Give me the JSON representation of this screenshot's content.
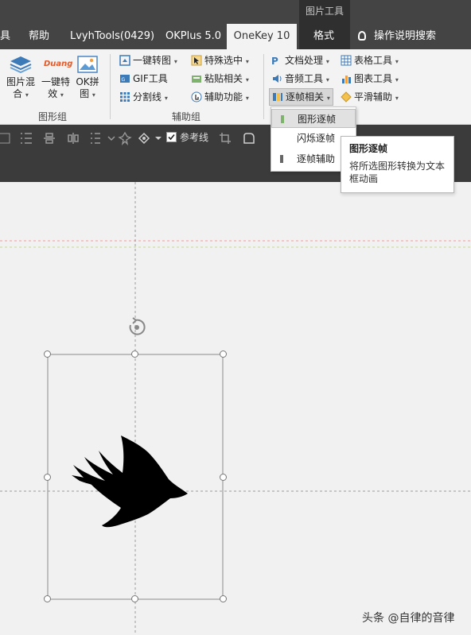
{
  "context_tab_title": "图片工具",
  "tabs": [
    {
      "label": "具"
    },
    {
      "label": "帮助"
    },
    {
      "label": "LvyhTools(0429)"
    },
    {
      "label": "OKPlus 5.0"
    },
    {
      "label": "OneKey 10"
    },
    {
      "label": "格式"
    }
  ],
  "search_label": "操作说明搜索",
  "ribbon": {
    "image_group": {
      "label": "图形组",
      "buttons": [
        {
          "label_line1": "图片混",
          "label_line2": "合"
        },
        {
          "label_line1": "一键特",
          "label_line2": "效",
          "icon_text": "Duang"
        },
        {
          "label_line1": "OK拼",
          "label_line2": "图"
        }
      ]
    },
    "assist_group": {
      "label": "辅助组",
      "buttons": [
        "一键转图",
        "GIF工具",
        "分割线",
        "特殊选中",
        "粘贴相关",
        "辅助功能"
      ]
    },
    "more_buttons": [
      "文档处理",
      "音频工具",
      "逐帧相关",
      "表格工具",
      "图表工具",
      "平滑辅助"
    ]
  },
  "toolbar": {
    "checkbox_label": "参考线",
    "checkbox_checked": true
  },
  "dropdown": {
    "items": [
      "图形逐帧",
      "闪烁逐帧",
      "逐帧辅助"
    ],
    "hovered_index": 0
  },
  "tooltip": {
    "title": "图形逐帧",
    "description_line1": "将所选图形转换为文本",
    "description_line2": "框动画"
  },
  "watermark": "头条 @自律的音律",
  "colors": {
    "tab_bar": "#444444",
    "context_tab": "#2f2f2f",
    "ribbon": "#f3f3f3",
    "toolbar": "#3b3b3b",
    "canvas": "#f1f1f1",
    "guide_red": "#e8a0a0",
    "guide_green": "#c8d89a"
  }
}
